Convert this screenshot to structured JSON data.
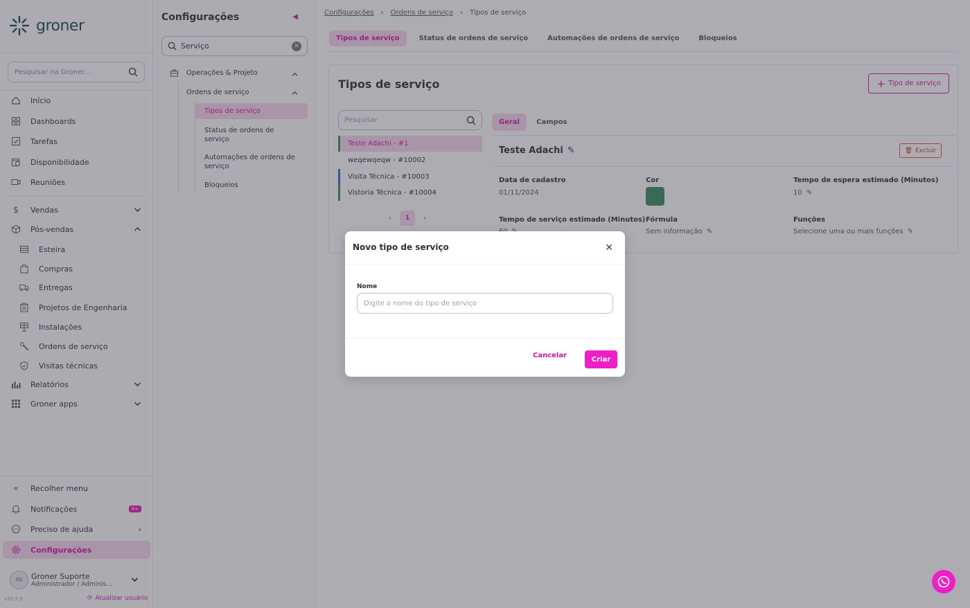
{
  "brand": {
    "name": "groner",
    "accent": "#d315ab",
    "accent_light": "#f6d6ef"
  },
  "sidebar": {
    "search_placeholder": "Pesquisar na Groner...",
    "items": [
      {
        "label": "Início",
        "icon": "home-icon"
      },
      {
        "label": "Dashboards",
        "icon": "dashboard-icon"
      },
      {
        "label": "Tarefas",
        "icon": "checkbox-icon"
      },
      {
        "label": "Disponibilidade",
        "icon": "calendar-clock-icon"
      },
      {
        "label": "Reuniões",
        "icon": "video-icon"
      },
      {
        "label": "Vendas",
        "icon": "dollar-icon"
      },
      {
        "label": "Pós-vendas",
        "icon": "box-icon"
      },
      {
        "label": "Relatórios",
        "icon": "bar-chart-icon"
      },
      {
        "label": "Groner apps",
        "icon": "grid-icon"
      }
    ],
    "subitems": [
      {
        "label": "Esteira",
        "icon": "list-icon"
      },
      {
        "label": "Compras",
        "icon": "shopping-bag-icon"
      },
      {
        "label": "Entregas",
        "icon": "truck-icon"
      },
      {
        "label": "Projetos de Engenharia",
        "icon": "clipboard-icon"
      },
      {
        "label": "Instalações",
        "icon": "solar-panel-icon"
      },
      {
        "label": "Ordens de serviço",
        "icon": "wrench-icon"
      },
      {
        "label": "Visitas técnicas",
        "icon": "shield-check-icon"
      }
    ],
    "bottom": {
      "collapse": "Recolher menu",
      "notifications": "Notificações",
      "notifications_badge": "9+",
      "help": "Preciso de ajuda",
      "settings": "Configurações"
    },
    "user": {
      "name": "Groner Suporte",
      "role": "Administrador / Adminis...",
      "avatar_text": "GS"
    },
    "version": "v20.7.3",
    "update_user": "Atualizar usuário"
  },
  "config": {
    "title": "Configurações",
    "search_value": "Serviço",
    "tree": {
      "group": "Operações & Projeto",
      "section": "Ordens de serviço",
      "items": [
        "Tipos de serviço",
        "Status de ordens de serviço",
        "Automações de ordens de serviço",
        "Bloqueios"
      ]
    }
  },
  "main": {
    "breadcrumb": [
      "Configurações",
      "Ordens de serviço",
      "Tipos de serviço"
    ],
    "tabs": [
      "Tipos de serviço",
      "Status de ordens de serviço",
      "Automações de ordens de serviço",
      "Bloqueios"
    ],
    "card_title": "Tipos de serviço",
    "add_button": "Tipo de serviço",
    "list_search_placeholder": "Pesquisar",
    "list": [
      {
        "label": "Teste Adachi - #1",
        "color": ""
      },
      {
        "label": "weqewqeqw - #10002",
        "color": ""
      },
      {
        "label": "Visita Técnica - #10003",
        "color": "#2d6bd6"
      },
      {
        "label": "Vistoria Técnica - #10004",
        "color": "#3a8a60"
      }
    ],
    "page": "1",
    "detail": {
      "tabs": [
        "Geral",
        "Campos"
      ],
      "name": "Teste Adachi",
      "delete": "Excluir",
      "fields": {
        "created_label": "Data de cadastro",
        "created_value": "01/11/2024",
        "color_label": "Cor",
        "color_value": "#3a8a60",
        "wait_label": "Tempo de espera estimado (Minutos)",
        "wait_value": "10",
        "service_label": "Tempo de serviço estimado (Minutos)",
        "service_value": "60",
        "formula_label": "Fórmula",
        "formula_value": "Sem informação",
        "functions_label": "Funções",
        "functions_value": "Selecione uma ou mais funções"
      }
    }
  },
  "modal": {
    "title": "Novo tipo de serviço",
    "name_label": "Nome",
    "name_placeholder": "Digite o nome do tipo de serviço",
    "cancel": "Cancelar",
    "create": "Criar"
  }
}
